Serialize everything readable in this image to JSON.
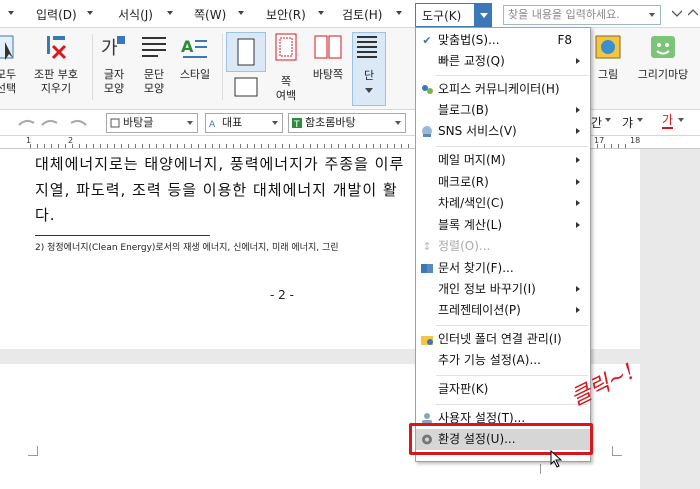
{
  "menubar": {
    "items": [
      "입력(D)",
      "서식(J)",
      "쪽(W)",
      "보안(R)",
      "검토(H)"
    ],
    "active": "도구(K)",
    "search_placeholder": "찾을 내용을 입력하세요."
  },
  "ribbon": {
    "buttons": [
      {
        "label1": "모두",
        "label2": "선택",
        "icon": "select-all-icon"
      },
      {
        "label1": "조판 부호",
        "label2": "지우기",
        "icon": "clear-formatting-icon"
      },
      {
        "label1": "글자",
        "label2": "모양",
        "icon": "char-shape-icon"
      },
      {
        "label1": "문단",
        "label2": "모양",
        "icon": "para-shape-icon"
      },
      {
        "label1": "스타일",
        "label2": "",
        "icon": "style-icon"
      },
      {
        "label1": "쪽",
        "label2": "여백",
        "icon": "page-margin-icon"
      },
      {
        "label1": "바탕쪽",
        "label2": "",
        "icon": "master-page-icon"
      },
      {
        "label1": "단",
        "label2": "",
        "icon": "column-icon"
      },
      {
        "label1": "그림",
        "label2": "",
        "icon": "picture-icon"
      },
      {
        "label1": "그리기마당",
        "label2": "",
        "icon": "clipart-icon"
      }
    ]
  },
  "format": {
    "style": "바탕글",
    "group": "대표",
    "font": "함초롬바탕"
  },
  "ruler": {
    "numbers": [
      "1",
      "2",
      "17",
      "18"
    ]
  },
  "document": {
    "line1": "대체에너지로는 태양에너지, 풍력에너지가 주종을 이루",
    "line2": "지열, 파도력, 조력 등을 이용한 대체에너지 개발이 활",
    "line3": "다.",
    "footnote": "2) 청정에너지(Clean Energy)로서의 재생 에너지, 신에너지, 미래 에너지, 그린",
    "page_number": "- 2 -"
  },
  "dropdown": {
    "items": [
      {
        "label": "맞춤법(S)...",
        "shortcut": "F8",
        "icon": "spellcheck-icon",
        "submenu": false
      },
      {
        "label": "빠른 교정(Q)",
        "shortcut": "",
        "icon": "",
        "submenu": true
      },
      {
        "label": "오피스 커뮤니케이터(H)",
        "shortcut": "",
        "icon": "communicator-icon",
        "submenu": false
      },
      {
        "label": "블로그(B)",
        "shortcut": "",
        "icon": "",
        "submenu": true
      },
      {
        "label": "SNS 서비스(V)",
        "shortcut": "",
        "icon": "sns-icon",
        "submenu": true
      },
      {
        "label": "메일 머지(M)",
        "shortcut": "",
        "icon": "",
        "submenu": true
      },
      {
        "label": "매크로(R)",
        "shortcut": "",
        "icon": "",
        "submenu": true
      },
      {
        "label": "차례/색인(C)",
        "shortcut": "",
        "icon": "",
        "submenu": true
      },
      {
        "label": "블록 계산(L)",
        "shortcut": "",
        "icon": "",
        "submenu": true
      },
      {
        "label": "정렬(O)...",
        "shortcut": "",
        "icon": "sort-icon",
        "submenu": false,
        "disabled": true
      },
      {
        "label": "문서 찾기(F)...",
        "shortcut": "",
        "icon": "find-document-icon",
        "submenu": false
      },
      {
        "label": "개인 정보 바꾸기(I)",
        "shortcut": "",
        "icon": "",
        "submenu": true
      },
      {
        "label": "프레젠테이션(P)",
        "shortcut": "",
        "icon": "",
        "submenu": true
      },
      {
        "label": "인터넷 폴더 연결 관리(I)",
        "shortcut": "",
        "icon": "internet-folder-icon",
        "submenu": false
      },
      {
        "label": "추가 기능 설정(A)...",
        "shortcut": "",
        "icon": "",
        "submenu": false
      },
      {
        "label": "글자판(K)",
        "shortcut": "",
        "icon": "",
        "submenu": false
      },
      {
        "label": "사용자 설정(T)...",
        "shortcut": "",
        "icon": "user-settings-icon",
        "submenu": false
      },
      {
        "label": "환경 설정(U)...",
        "shortcut": "",
        "icon": "gear-icon",
        "submenu": false,
        "highlighted": true
      }
    ]
  },
  "annotation": {
    "text": "클릭~!"
  },
  "colors": {
    "accent": "#3a78b8",
    "highlight_box": "#d9161c"
  }
}
